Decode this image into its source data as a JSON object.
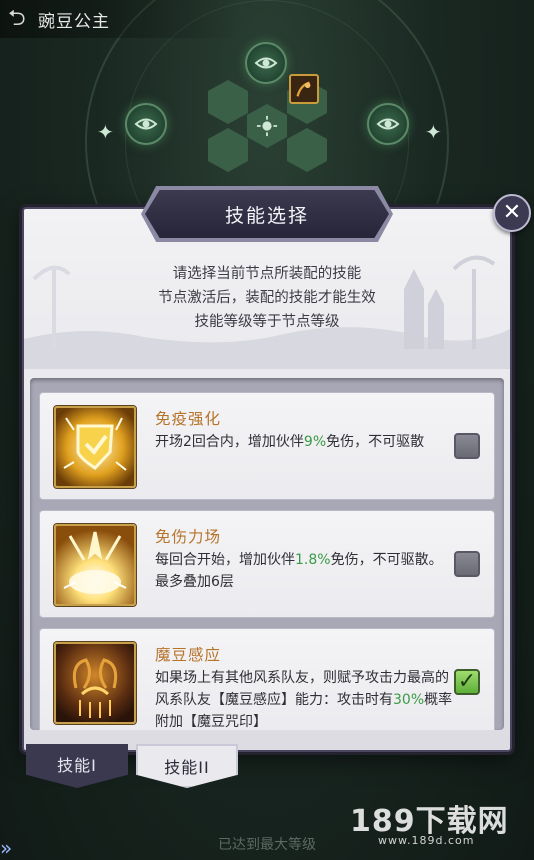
{
  "header": {
    "title": "豌豆公主",
    "back_icon": "back-arrow-icon"
  },
  "modal": {
    "title": "技能选择",
    "close_icon": "close-icon",
    "description": [
      "请选择当前节点所装配的技能",
      "节点激活后，装配的技能才能生效",
      "技能等级等于节点等级"
    ]
  },
  "skills": [
    {
      "name": "免疫强化",
      "desc_before": "开场2回合内，增加伙伴",
      "highlight": "9%",
      "desc_after": "免伤，不可驱散",
      "checked": false
    },
    {
      "name": "免伤力场",
      "desc_before": "每回合开始，增加伙伴",
      "highlight": "1.8%",
      "desc_after": "免伤，不可驱散。最多叠加6层",
      "checked": false
    },
    {
      "name": "魔豆感应",
      "desc_before": "如果场上有其他风系队友，则赋予攻击力最高的风系队友【魔豆感应】能力：攻击时有",
      "highlight": "30%",
      "desc_after": "概率附加【魔豆咒印】",
      "checked": true
    }
  ],
  "tabs": [
    {
      "label": "技能I",
      "active": false
    },
    {
      "label": "技能II",
      "active": true
    }
  ],
  "footer": {
    "status": "已达到最大等级"
  },
  "watermark": {
    "text": "189下载网",
    "url": "www.189d.com"
  },
  "colors": {
    "skill_name": "#b6732a",
    "highlight": "#3a9a46",
    "modal_frame": "#3b3a52"
  }
}
